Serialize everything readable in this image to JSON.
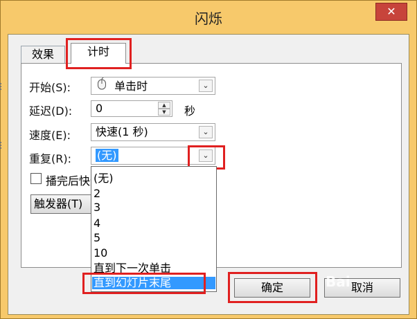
{
  "dialog": {
    "title": "闪烁",
    "close_glyph": "✕"
  },
  "tabs": [
    {
      "label": "效果"
    },
    {
      "label": "计时"
    }
  ],
  "timing": {
    "start_label": "开始(S):",
    "start_value": "单击时",
    "delay_label": "延迟(D):",
    "delay_value": "0",
    "delay_unit": "秒",
    "speed_label": "速度(E):",
    "speed_value": "快速(1 秒)",
    "repeat_label": "重复(R):",
    "repeat_value": "(无)",
    "rewind_label": "播完后快退",
    "trigger_label": "触发器(T)"
  },
  "repeat_options": [
    "(无)",
    "2",
    "3",
    "4",
    "5",
    "10",
    "直到下一次单击",
    "直到幻灯片末尾"
  ],
  "selected_option": "直到幻灯片末尾",
  "buttons": {
    "ok": "确定",
    "cancel": "取消"
  },
  "watermark": "Bai"
}
